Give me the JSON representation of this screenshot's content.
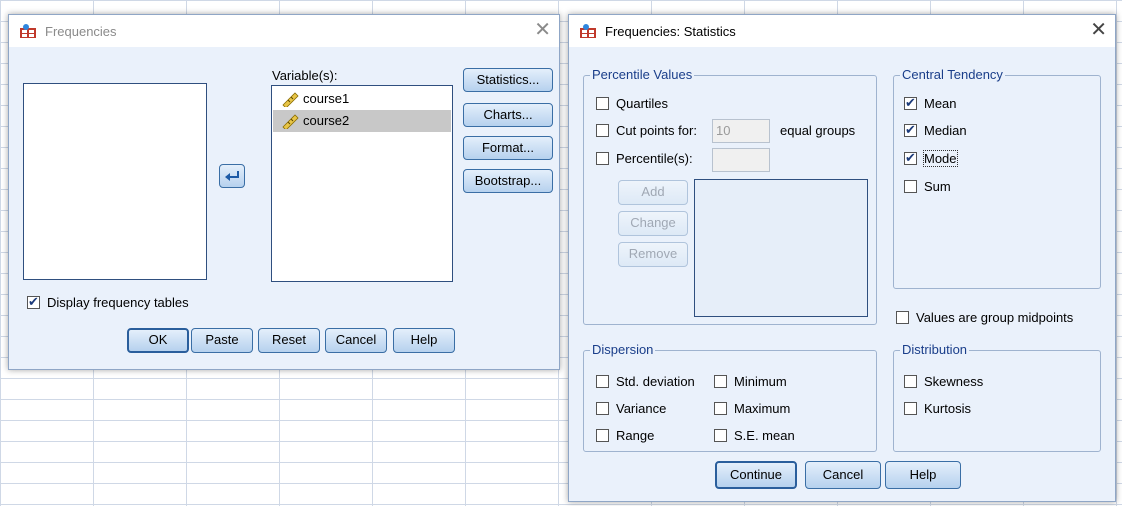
{
  "frequencies": {
    "title": "Frequencies",
    "close_glyph": "✕",
    "variables_label": "Variable(s):",
    "variables": [
      "course1",
      "course2"
    ],
    "side_buttons": [
      "Statistics...",
      "Charts...",
      "Format...",
      "Bootstrap..."
    ],
    "display_tables_label": "Display frequency tables",
    "buttons": {
      "ok": "OK",
      "paste": "Paste",
      "reset": "Reset",
      "cancel": "Cancel",
      "help": "Help"
    }
  },
  "statistics": {
    "title": "Frequencies: Statistics",
    "close_glyph": "✕",
    "percentile_values": {
      "legend": "Percentile Values",
      "quartiles": "Quartiles",
      "cut_points": "Cut points for:",
      "cut_points_value": "10",
      "equal_groups": "equal groups",
      "percentiles": "Percentile(s):",
      "add": "Add",
      "change": "Change",
      "remove": "Remove"
    },
    "central_tendency": {
      "legend": "Central Tendency",
      "mean": "Mean",
      "median": "Median",
      "mode": "Mode",
      "sum": "Sum"
    },
    "group_midpoints": "Values are group midpoints",
    "dispersion": {
      "legend": "Dispersion",
      "std_deviation": "Std. deviation",
      "minimum": "Minimum",
      "variance": "Variance",
      "maximum": "Maximum",
      "range": "Range",
      "se_mean": "S.E. mean"
    },
    "distribution": {
      "legend": "Distribution",
      "skewness": "Skewness",
      "kurtosis": "Kurtosis"
    },
    "buttons": {
      "continue": "Continue",
      "cancel": "Cancel",
      "help": "Help"
    }
  }
}
